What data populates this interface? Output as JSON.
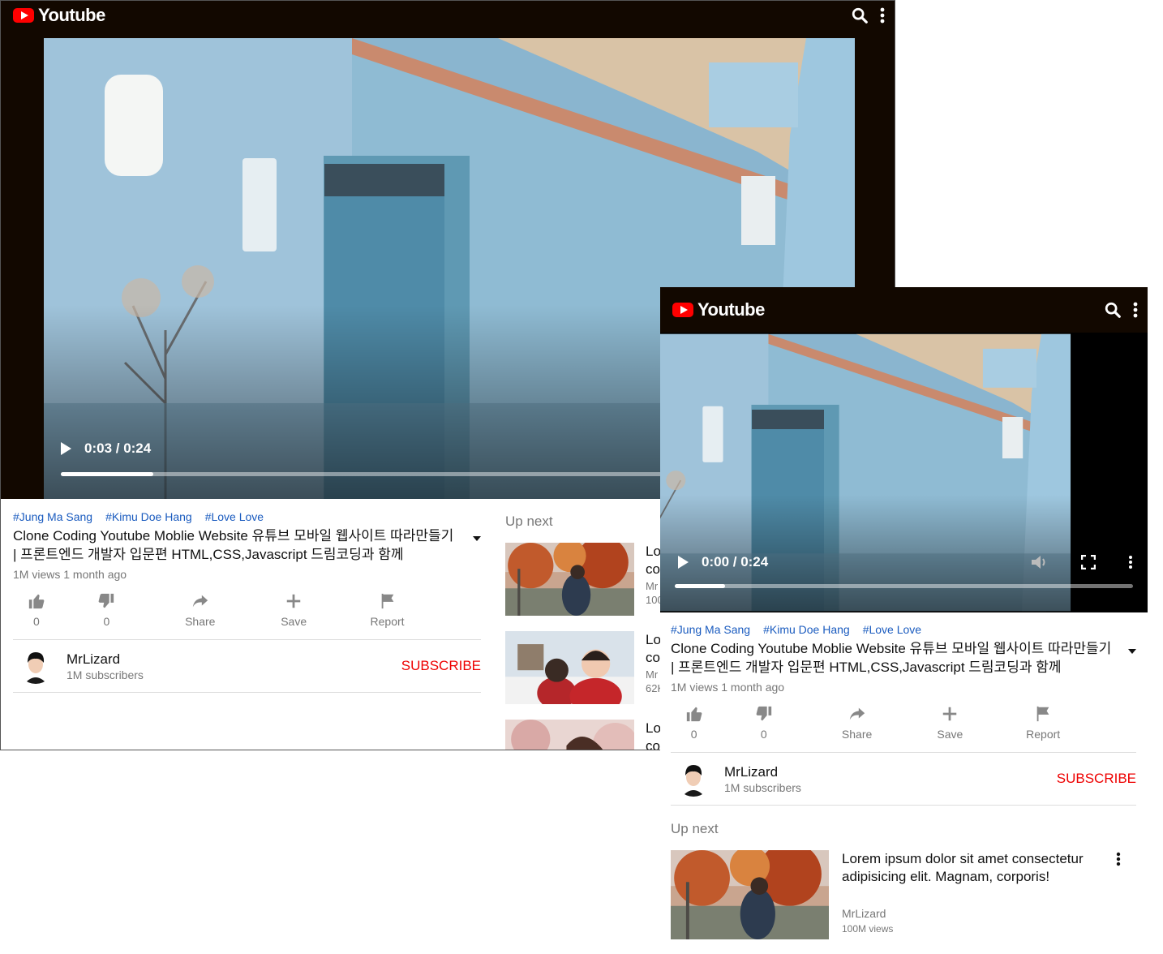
{
  "app": {
    "name": "Youtube"
  },
  "colors": {
    "bar": "#120800",
    "brand": "#ff0000",
    "tag": "#1a5bbf",
    "subscribe": "#e00000"
  },
  "desktop": {
    "time": "0:03 / 0:24",
    "progress": 0.13,
    "buffered": 0.8
  },
  "mobile": {
    "time": "0:00 / 0:24",
    "progress": 0.11
  },
  "video": {
    "tags": [
      "#Jung Ma Sang",
      "#Kimu Doe Hang",
      "#Love Love"
    ],
    "title": "Clone Coding Youtube Moblie Website 유튜브 모바일 웹사이트 따라만들기 | 프론트엔드 개발자 입문편 HTML,CSS,Javascript 드림코딩과 함께",
    "meta": "1M views 1 month ago",
    "actions": {
      "like": "0",
      "dislike": "0",
      "share": "Share",
      "save": "Save",
      "report": "Report"
    }
  },
  "channel": {
    "name": "MrLizard",
    "subscribers": "1M subscribers",
    "subscribe_label": "SUBSCRIBE"
  },
  "upnext": {
    "label": "Up next",
    "items": [
      {
        "title_clip": "Lo",
        "title_clip2": "co",
        "meta_clip": "Mr",
        "meta_clip2": "100"
      },
      {
        "title_clip": "Lo",
        "title_clip2": "co",
        "meta_clip": "Mr",
        "meta_clip2": "62K"
      },
      {
        "title_clip": "Lo",
        "title_clip2": "co",
        "meta_clip": "",
        "meta_clip2": ""
      }
    ],
    "mobile_item": {
      "title": "Lorem ipsum dolor sit amet consectetur adipisicing elit. Magnam, corporis!",
      "channel": "MrLizard",
      "views": "100M views"
    }
  }
}
